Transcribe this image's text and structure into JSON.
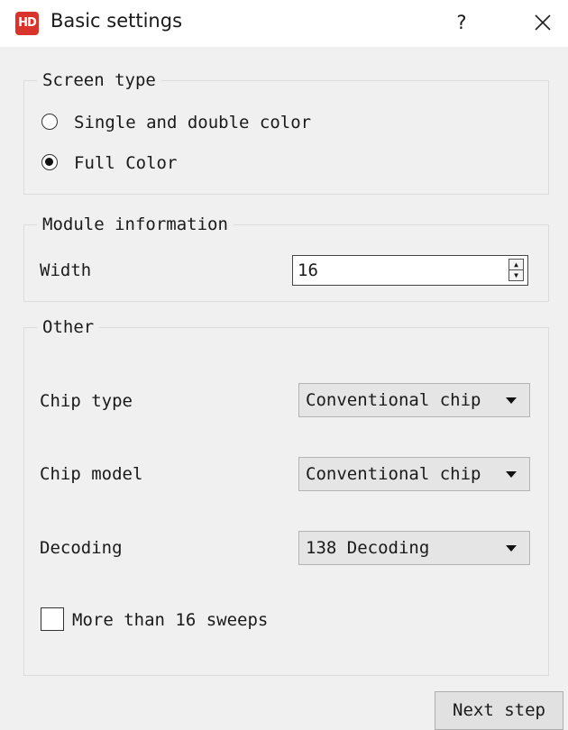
{
  "window": {
    "title": "Basic settings",
    "app_icon_text": "HD",
    "help_label": "?"
  },
  "screen_type": {
    "legend": "Screen type",
    "options": [
      {
        "label": "Single and double color",
        "selected": false
      },
      {
        "label": "Full Color",
        "selected": true
      }
    ]
  },
  "module_information": {
    "legend": "Module information",
    "width_label": "Width",
    "width_value": "16"
  },
  "other": {
    "legend": "Other",
    "chip_type_label": "Chip type",
    "chip_type_value": "Conventional chip",
    "chip_model_label": "Chip model",
    "chip_model_value": "Conventional chip",
    "decoding_label": "Decoding",
    "decoding_value": "138 Decoding",
    "sweeps_label": "More than 16 sweeps",
    "sweeps_checked": false
  },
  "footer": {
    "next_label": "Next step"
  },
  "colors": {
    "app_icon": "#d9342b",
    "window_bg": "#f0f0f0",
    "titlebar_bg": "#ffffff"
  }
}
